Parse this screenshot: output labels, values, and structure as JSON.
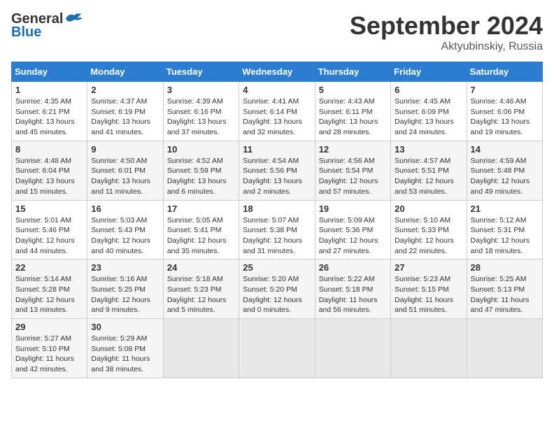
{
  "header": {
    "logo_general": "General",
    "logo_blue": "Blue",
    "month": "September 2024",
    "location": "Aktyubinskiy, Russia"
  },
  "days_of_week": [
    "Sunday",
    "Monday",
    "Tuesday",
    "Wednesday",
    "Thursday",
    "Friday",
    "Saturday"
  ],
  "weeks": [
    [
      {
        "day": 1,
        "sunrise": "4:35 AM",
        "sunset": "6:21 PM",
        "daylight": "13 hours and 45 minutes."
      },
      {
        "day": 2,
        "sunrise": "4:37 AM",
        "sunset": "6:19 PM",
        "daylight": "13 hours and 41 minutes."
      },
      {
        "day": 3,
        "sunrise": "4:39 AM",
        "sunset": "6:16 PM",
        "daylight": "13 hours and 37 minutes."
      },
      {
        "day": 4,
        "sunrise": "4:41 AM",
        "sunset": "6:14 PM",
        "daylight": "13 hours and 32 minutes."
      },
      {
        "day": 5,
        "sunrise": "4:43 AM",
        "sunset": "6:11 PM",
        "daylight": "13 hours and 28 minutes."
      },
      {
        "day": 6,
        "sunrise": "4:45 AM",
        "sunset": "6:09 PM",
        "daylight": "13 hours and 24 minutes."
      },
      {
        "day": 7,
        "sunrise": "4:46 AM",
        "sunset": "6:06 PM",
        "daylight": "13 hours and 19 minutes."
      }
    ],
    [
      {
        "day": 8,
        "sunrise": "4:48 AM",
        "sunset": "6:04 PM",
        "daylight": "13 hours and 15 minutes."
      },
      {
        "day": 9,
        "sunrise": "4:50 AM",
        "sunset": "6:01 PM",
        "daylight": "13 hours and 11 minutes."
      },
      {
        "day": 10,
        "sunrise": "4:52 AM",
        "sunset": "5:59 PM",
        "daylight": "13 hours and 6 minutes."
      },
      {
        "day": 11,
        "sunrise": "4:54 AM",
        "sunset": "5:56 PM",
        "daylight": "13 hours and 2 minutes."
      },
      {
        "day": 12,
        "sunrise": "4:56 AM",
        "sunset": "5:54 PM",
        "daylight": "12 hours and 57 minutes."
      },
      {
        "day": 13,
        "sunrise": "4:57 AM",
        "sunset": "5:51 PM",
        "daylight": "12 hours and 53 minutes."
      },
      {
        "day": 14,
        "sunrise": "4:59 AM",
        "sunset": "5:48 PM",
        "daylight": "12 hours and 49 minutes."
      }
    ],
    [
      {
        "day": 15,
        "sunrise": "5:01 AM",
        "sunset": "5:46 PM",
        "daylight": "12 hours and 44 minutes."
      },
      {
        "day": 16,
        "sunrise": "5:03 AM",
        "sunset": "5:43 PM",
        "daylight": "12 hours and 40 minutes."
      },
      {
        "day": 17,
        "sunrise": "5:05 AM",
        "sunset": "5:41 PM",
        "daylight": "12 hours and 35 minutes."
      },
      {
        "day": 18,
        "sunrise": "5:07 AM",
        "sunset": "5:38 PM",
        "daylight": "12 hours and 31 minutes."
      },
      {
        "day": 19,
        "sunrise": "5:09 AM",
        "sunset": "5:36 PM",
        "daylight": "12 hours and 27 minutes."
      },
      {
        "day": 20,
        "sunrise": "5:10 AM",
        "sunset": "5:33 PM",
        "daylight": "12 hours and 22 minutes."
      },
      {
        "day": 21,
        "sunrise": "5:12 AM",
        "sunset": "5:31 PM",
        "daylight": "12 hours and 18 minutes."
      }
    ],
    [
      {
        "day": 22,
        "sunrise": "5:14 AM",
        "sunset": "5:28 PM",
        "daylight": "12 hours and 13 minutes."
      },
      {
        "day": 23,
        "sunrise": "5:16 AM",
        "sunset": "5:25 PM",
        "daylight": "12 hours and 9 minutes."
      },
      {
        "day": 24,
        "sunrise": "5:18 AM",
        "sunset": "5:23 PM",
        "daylight": "12 hours and 5 minutes."
      },
      {
        "day": 25,
        "sunrise": "5:20 AM",
        "sunset": "5:20 PM",
        "daylight": "12 hours and 0 minutes."
      },
      {
        "day": 26,
        "sunrise": "5:22 AM",
        "sunset": "5:18 PM",
        "daylight": "11 hours and 56 minutes."
      },
      {
        "day": 27,
        "sunrise": "5:23 AM",
        "sunset": "5:15 PM",
        "daylight": "11 hours and 51 minutes."
      },
      {
        "day": 28,
        "sunrise": "5:25 AM",
        "sunset": "5:13 PM",
        "daylight": "11 hours and 47 minutes."
      }
    ],
    [
      {
        "day": 29,
        "sunrise": "5:27 AM",
        "sunset": "5:10 PM",
        "daylight": "11 hours and 42 minutes."
      },
      {
        "day": 30,
        "sunrise": "5:29 AM",
        "sunset": "5:08 PM",
        "daylight": "11 hours and 38 minutes."
      },
      null,
      null,
      null,
      null,
      null
    ]
  ],
  "labels": {
    "sunrise": "Sunrise:",
    "sunset": "Sunset:",
    "daylight": "Daylight:"
  }
}
